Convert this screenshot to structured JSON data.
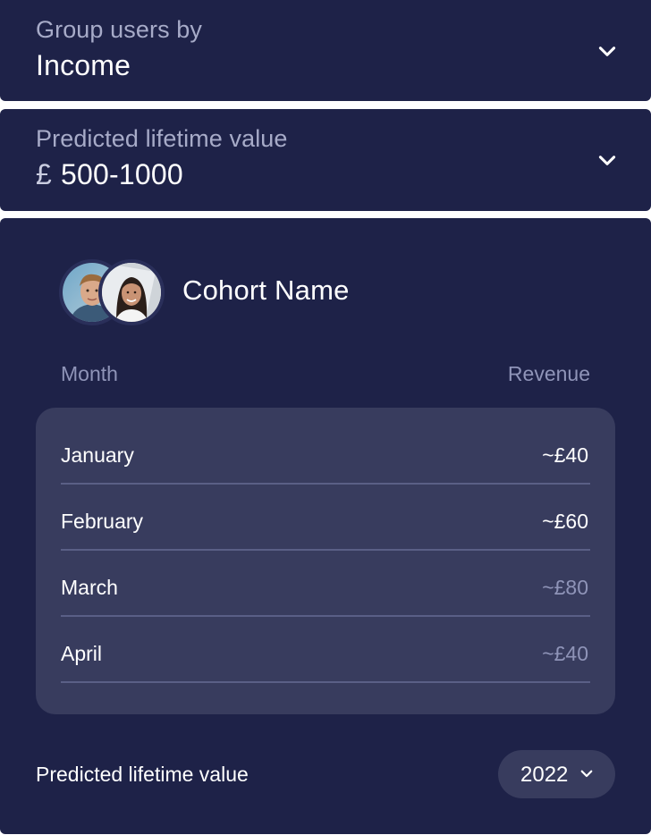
{
  "group_dropdown": {
    "label": "Group users by",
    "value": "Income",
    "icon": "chevron-down-icon"
  },
  "ltv_dropdown": {
    "label": "Predicted lifetime value",
    "currency": "£",
    "value": "500-1000",
    "icon": "chevron-down-icon"
  },
  "cohort": {
    "title": "Cohort Name",
    "avatars": [
      "avatar-man",
      "avatar-woman"
    ]
  },
  "table": {
    "headers": {
      "month": "Month",
      "revenue": "Revenue"
    },
    "rows": [
      {
        "month": "January",
        "revenue": "~£40",
        "dimmed": false
      },
      {
        "month": "February",
        "revenue": "~£60",
        "dimmed": false
      },
      {
        "month": "March",
        "revenue": "~£80",
        "dimmed": true
      },
      {
        "month": "April",
        "revenue": "~£40",
        "dimmed": true
      }
    ]
  },
  "footer": {
    "label": "Predicted lifetime value",
    "year": "2022"
  },
  "colors": {
    "card_bg": "#1e2248",
    "table_bg": "#383c5e",
    "muted_text": "#8f94b8",
    "text": "#ffffff"
  }
}
